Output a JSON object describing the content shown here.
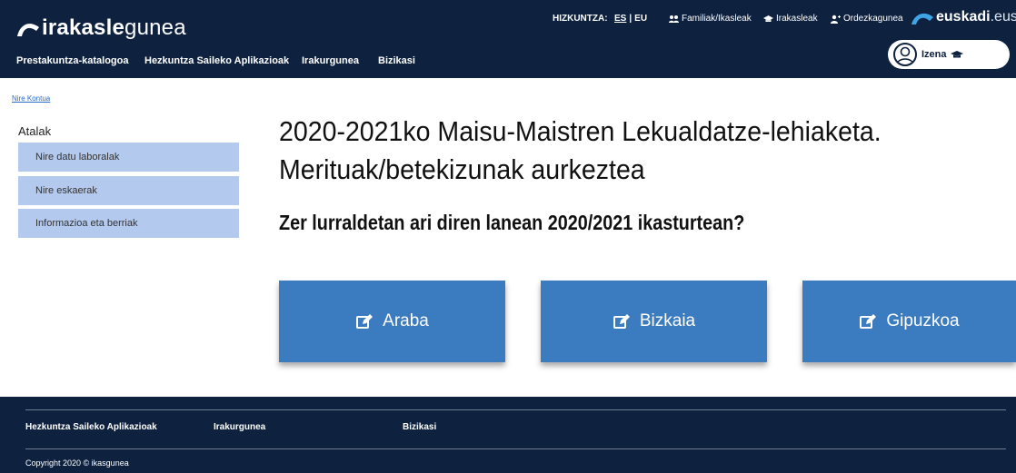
{
  "brand": {
    "logo_bold": "irakasle",
    "logo_light": "gunea",
    "partner_bold": "euskadi",
    "partner_light": ".eus"
  },
  "topbar": {
    "language_label": "HIZKUNTZA:",
    "lang_es": "ES",
    "lang_sep": "|",
    "lang_eu": "EU",
    "links": [
      {
        "label": "Familiak/Ikasleak",
        "icon": "users-icon"
      },
      {
        "label": "Irakasleak",
        "icon": "graduation-cap-icon"
      },
      {
        "label": "Ordezkagunea",
        "icon": "user-plus-icon"
      }
    ]
  },
  "mainnav": {
    "items": [
      "Prestakuntza-katalogoa",
      "Hezkuntza Saileko Aplikazioak",
      "Irakurgunea",
      "Bizikasi"
    ]
  },
  "user": {
    "name": "Izena",
    "icon": "graduation-cap-icon"
  },
  "breadcrumb": "Nire Kontua",
  "sidebar": {
    "title": "Atalak",
    "items": [
      "Nire datu laboralak",
      "Nire eskaerak",
      "Informazioa eta berriak"
    ]
  },
  "main": {
    "title": "2020-2021ko Maisu-Maistren Lekualdatze-lehiaketa. Merituak/betekizunak aurkeztea",
    "question": "Zer lurraldetan ari diren lanean 2020/2021 ikasturtean?",
    "buttons": [
      "Araba",
      "Bizkaia",
      "Gipuzkoa"
    ],
    "button_icon": "edit-icon"
  },
  "footer": {
    "links": [
      "Hezkuntza Saileko Aplikazioak",
      "Irakurgunea",
      "Bizikasi"
    ],
    "copyright": "Copyright 2020 © ikasgunea"
  },
  "colors": {
    "header_bg": "#0e2240",
    "button_bg": "#3b7bbf",
    "sidebar_item_bg": "#b3c9ee",
    "link": "#2a6cc4"
  }
}
